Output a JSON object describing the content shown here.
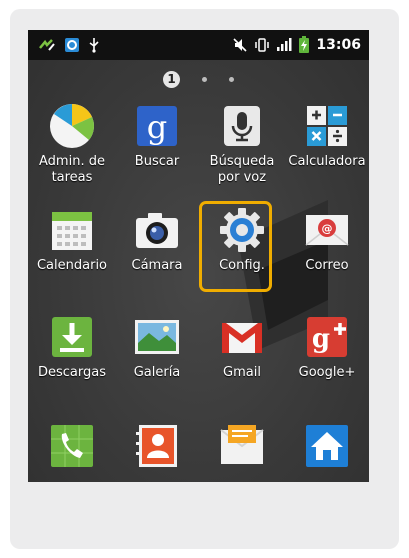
{
  "status_bar": {
    "time": "13:06"
  },
  "pager": {
    "current_page": "1"
  },
  "apps": [
    {
      "label": "Admin. de tareas",
      "icon": "pie-chart-icon"
    },
    {
      "label": "Buscar",
      "icon": "google-search-icon"
    },
    {
      "label": "Búsqueda por voz",
      "icon": "microphone-icon"
    },
    {
      "label": "Calculadora",
      "icon": "calculator-icon"
    },
    {
      "label": "Calendario",
      "icon": "calendar-icon"
    },
    {
      "label": "Cámara",
      "icon": "camera-icon"
    },
    {
      "label": "Config.",
      "icon": "gear-icon",
      "highlighted": true
    },
    {
      "label": "Correo",
      "icon": "email-icon"
    },
    {
      "label": "Descargas",
      "icon": "download-icon"
    },
    {
      "label": "Galería",
      "icon": "gallery-icon"
    },
    {
      "label": "Gmail",
      "icon": "gmail-icon"
    },
    {
      "label": "Google+",
      "icon": "google-plus-icon"
    },
    {
      "label": "",
      "icon": "phone-icon"
    },
    {
      "label": "",
      "icon": "contacts-icon"
    },
    {
      "label": "",
      "icon": "messaging-icon"
    },
    {
      "label": "",
      "icon": "home-icon"
    }
  ],
  "colors": {
    "highlight": "#f0ad00",
    "screen_bg": "#3b3b3b",
    "status_bar": "#111111"
  }
}
